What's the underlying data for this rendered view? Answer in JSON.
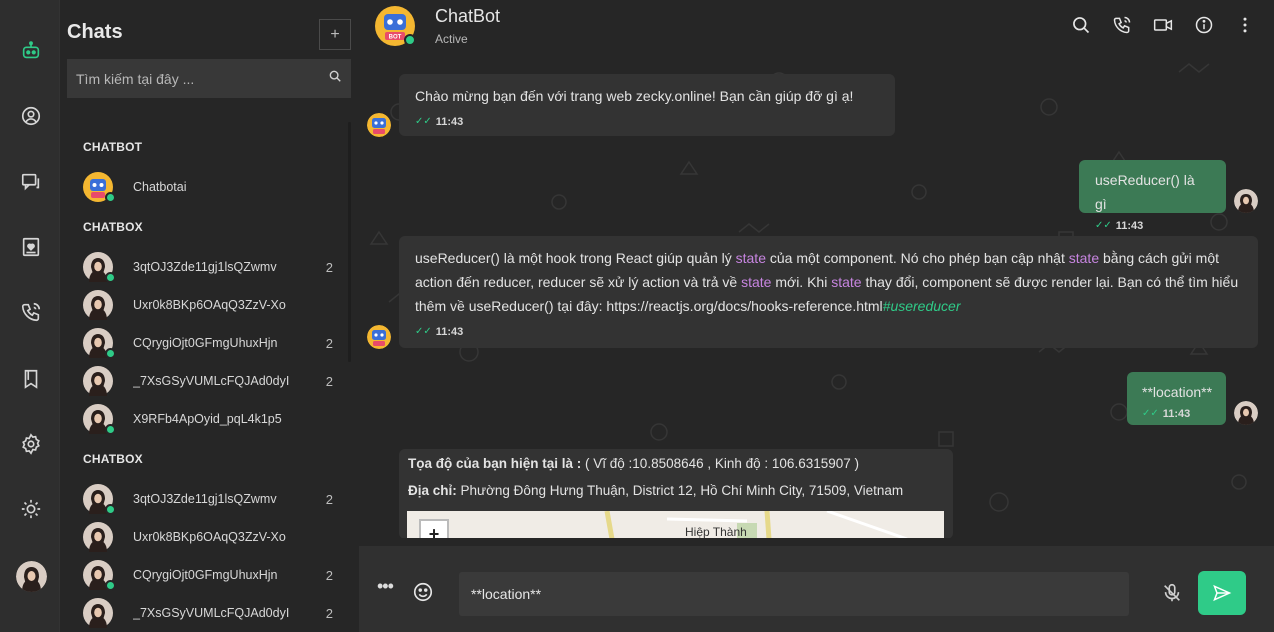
{
  "chatlist": {
    "title": "Chats",
    "add_label": "+",
    "search_placeholder": "Tìm kiếm tại đây ...",
    "sections": [
      {
        "label": "CHATBOT"
      },
      {
        "label": "CHATBOX"
      },
      {
        "label": "CHATBOX"
      }
    ],
    "chatbot_rows": [
      {
        "name": "Chatbotai",
        "badge": ""
      }
    ],
    "chatbox_rows_1": [
      {
        "name": "3qtOJ3Zde11gj1lsQZwmv",
        "badge": "2"
      },
      {
        "name": "Uxr0k8BKp6OAqQ3ZzV-Xo",
        "badge": ""
      },
      {
        "name": "CQrygiOjt0GFmgUhuxHjn",
        "badge": "2"
      },
      {
        "name": "_7XsGSyVUMLcFQJAd0dyI",
        "badge": "2"
      },
      {
        "name": "X9RFb4ApOyid_pqL4k1p5",
        "badge": ""
      }
    ],
    "chatbox_rows_2": [
      {
        "name": "3qtOJ3Zde11gj1lsQZwmv",
        "badge": "2"
      },
      {
        "name": "Uxr0k8BKp6OAqQ3ZzV-Xo",
        "badge": ""
      },
      {
        "name": "CQrygiOjt0GFmgUhuxHjn",
        "badge": "2"
      },
      {
        "name": "_7XsGSyVUMLcFQJAd0dyI",
        "badge": "2"
      }
    ]
  },
  "header": {
    "name": "ChatBot",
    "status": "Active",
    "bot_badge": "BOT"
  },
  "messages": {
    "m1": {
      "text": "Chào mừng bạn đến với trang web zecky.online! Bạn cần giúp đỡ gì ạ!",
      "time": "11:43"
    },
    "m2": {
      "text": "useReducer() là gì",
      "time": "11:43"
    },
    "m3": {
      "p1": "useReducer() là một hook trong React giúp quản lý ",
      "k1": "state",
      "p2": " của một component. Nó cho phép bạn cập nhật ",
      "k2": "state",
      "p3": " bằng cách gửi một action đến reducer, reducer sẽ xử lý action và trả về ",
      "k3": "state",
      "p4": " mới. Khi ",
      "k4": "state",
      "p5": " thay đổi, component sẽ được render lại. Bạn có thể tìm hiểu thêm về useReducer() tại đây: https://reactjs.org/docs/hooks-reference.html",
      "tag": "#usereducer",
      "time": "11:43"
    },
    "m4": {
      "text": "**location**",
      "time": "11:43"
    },
    "m5": {
      "coord_label": "Tọa độ của bạn hiện tại là :",
      "coord_value": " ( Vĩ độ :10.8508646 , Kinh độ : 106.6315907 )",
      "addr_label": "Địa chỉ:",
      "addr_value": " Phường Đông Hưng Thuận, District 12, Hồ Chí Minh City, 71509, Vietnam",
      "map_zoom": "+",
      "map_place": "Hiệp Thành"
    }
  },
  "composer": {
    "more": "•••",
    "value": "**location**"
  },
  "colors": {
    "accent": "#2fcb88",
    "my_bubble": "#3c7a55",
    "bot_bubble": "#333333",
    "keyword": "#c785e0"
  }
}
